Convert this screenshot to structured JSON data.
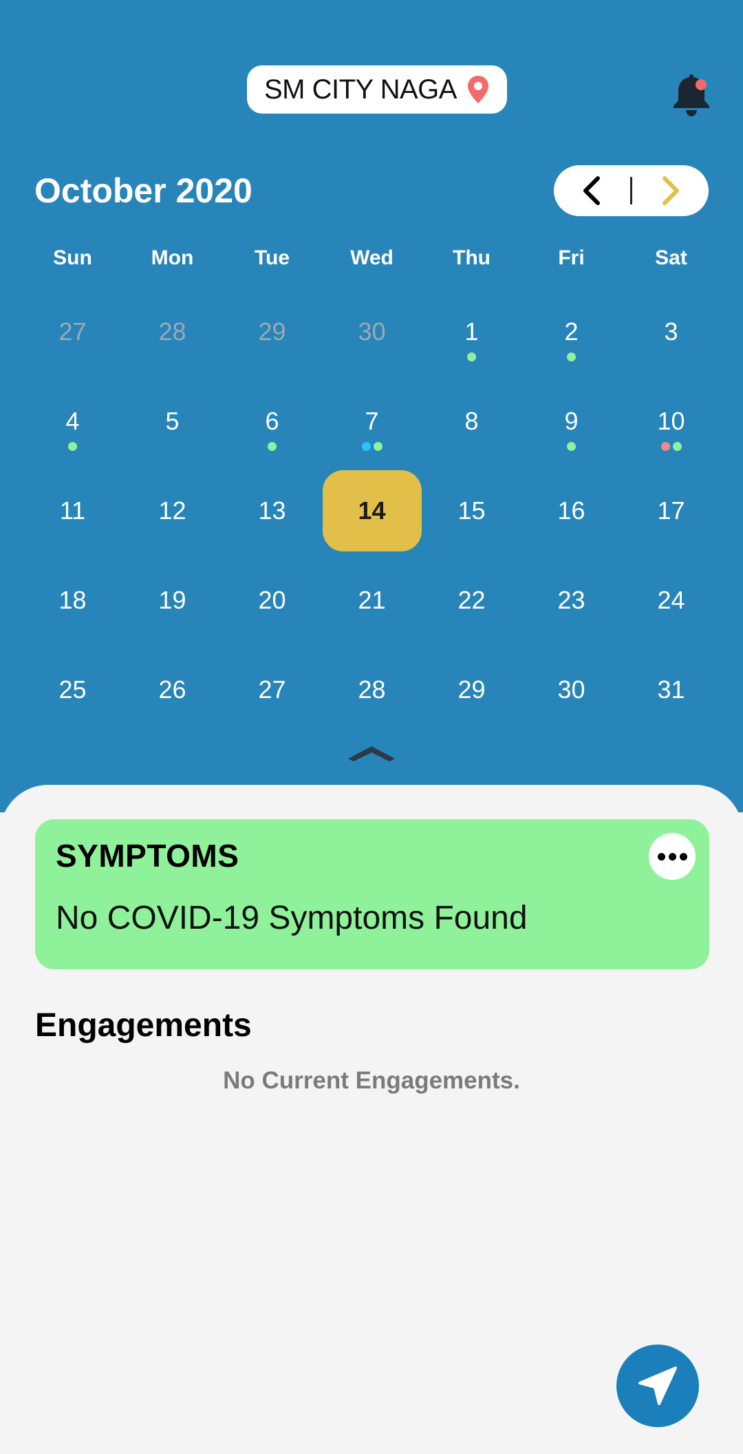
{
  "header": {
    "location": "SM CITY NAGA",
    "location_icon": "map-pin-icon",
    "notification_icon": "bell-icon",
    "notification_badge_color": "#f26b6b"
  },
  "calendar": {
    "month_title": "October 2020",
    "nav": {
      "prev_icon": "chevron-left-icon",
      "next_icon": "chevron-right-icon"
    },
    "weekdays": [
      "Sun",
      "Mon",
      "Tue",
      "Wed",
      "Thu",
      "Fri",
      "Sat"
    ],
    "weeks": [
      [
        {
          "label": "27",
          "muted": true,
          "dots": []
        },
        {
          "label": "28",
          "muted": true,
          "dots": []
        },
        {
          "label": "29",
          "muted": true,
          "dots": []
        },
        {
          "label": "30",
          "muted": true,
          "dots": []
        },
        {
          "label": "1",
          "muted": false,
          "dots": [
            "#8ff29b"
          ]
        },
        {
          "label": "2",
          "muted": false,
          "dots": [
            "#8ff29b"
          ]
        },
        {
          "label": "3",
          "muted": false,
          "dots": []
        }
      ],
      [
        {
          "label": "4",
          "muted": false,
          "dots": [
            "#8ff29b"
          ]
        },
        {
          "label": "5",
          "muted": false,
          "dots": []
        },
        {
          "label": "6",
          "muted": false,
          "dots": [
            "#8ff29b"
          ]
        },
        {
          "label": "7",
          "muted": false,
          "dots": [
            "#29c4f5",
            "#8ff29b"
          ]
        },
        {
          "label": "8",
          "muted": false,
          "dots": []
        },
        {
          "label": "9",
          "muted": false,
          "dots": [
            "#8ff29b"
          ]
        },
        {
          "label": "10",
          "muted": false,
          "dots": [
            "#f28a8a",
            "#8ff29b"
          ]
        }
      ],
      [
        {
          "label": "11",
          "muted": false,
          "dots": []
        },
        {
          "label": "12",
          "muted": false,
          "dots": []
        },
        {
          "label": "13",
          "muted": false,
          "dots": []
        },
        {
          "label": "14",
          "muted": false,
          "today": true,
          "dots": []
        },
        {
          "label": "15",
          "muted": false,
          "dots": []
        },
        {
          "label": "16",
          "muted": false,
          "dots": []
        },
        {
          "label": "17",
          "muted": false,
          "dots": []
        }
      ],
      [
        {
          "label": "18",
          "muted": false,
          "dots": []
        },
        {
          "label": "19",
          "muted": false,
          "dots": []
        },
        {
          "label": "20",
          "muted": false,
          "dots": []
        },
        {
          "label": "21",
          "muted": false,
          "dots": []
        },
        {
          "label": "22",
          "muted": false,
          "dots": []
        },
        {
          "label": "23",
          "muted": false,
          "dots": []
        },
        {
          "label": "24",
          "muted": false,
          "dots": []
        }
      ],
      [
        {
          "label": "25",
          "muted": false,
          "dots": []
        },
        {
          "label": "26",
          "muted": false,
          "dots": []
        },
        {
          "label": "27",
          "muted": false,
          "dots": []
        },
        {
          "label": "28",
          "muted": false,
          "dots": []
        },
        {
          "label": "29",
          "muted": false,
          "dots": []
        },
        {
          "label": "30",
          "muted": false,
          "dots": []
        },
        {
          "label": "31",
          "muted": false,
          "dots": []
        }
      ]
    ],
    "collapse_icon": "chevron-up-icon",
    "today_color": "#e2bf48"
  },
  "symptoms": {
    "title": "SYMPTOMS",
    "status": "No COVID-19 Symptoms Found",
    "more_icon": "more-horizontal-icon",
    "card_color": "#8ff29b"
  },
  "engagements": {
    "title": "Engagements",
    "empty_message": "No Current Engagements."
  },
  "fab": {
    "icon": "navigation-arrow-icon"
  },
  "colors": {
    "header_bg": "#2785b9",
    "sheet_bg": "#f4f4f4",
    "accent": "#e2bf48",
    "fab": "#1a7fba"
  }
}
